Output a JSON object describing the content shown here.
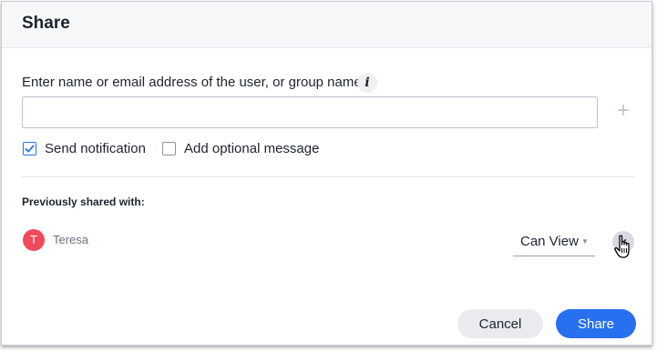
{
  "dialog": {
    "title": "Share",
    "field_label": "Enter name or email address of the user, or group name",
    "info_icon_glyph": "i",
    "input": {
      "value": "",
      "placeholder": ""
    },
    "add_icon_glyph": "+",
    "options": {
      "send_notification": {
        "label": "Send notification",
        "checked": true
      },
      "optional_message": {
        "label": "Add optional message",
        "checked": false
      }
    },
    "previously_shared_label": "Previously shared with:",
    "shared_users": [
      {
        "initial": "T",
        "name": "Teresa",
        "permission": "Can View",
        "avatar_color": "#f04a5b"
      }
    ],
    "remove_icon_glyph": "×",
    "buttons": {
      "cancel": "Cancel",
      "share": "Share"
    }
  },
  "colors": {
    "accent": "#2770ef",
    "header_bg": "#f6f7f9",
    "cancel_bg": "#e9ebee"
  },
  "icons": [
    "info-icon",
    "plus-icon",
    "check-icon",
    "chevron-down-icon",
    "close-icon",
    "hand-cursor-icon"
  ]
}
